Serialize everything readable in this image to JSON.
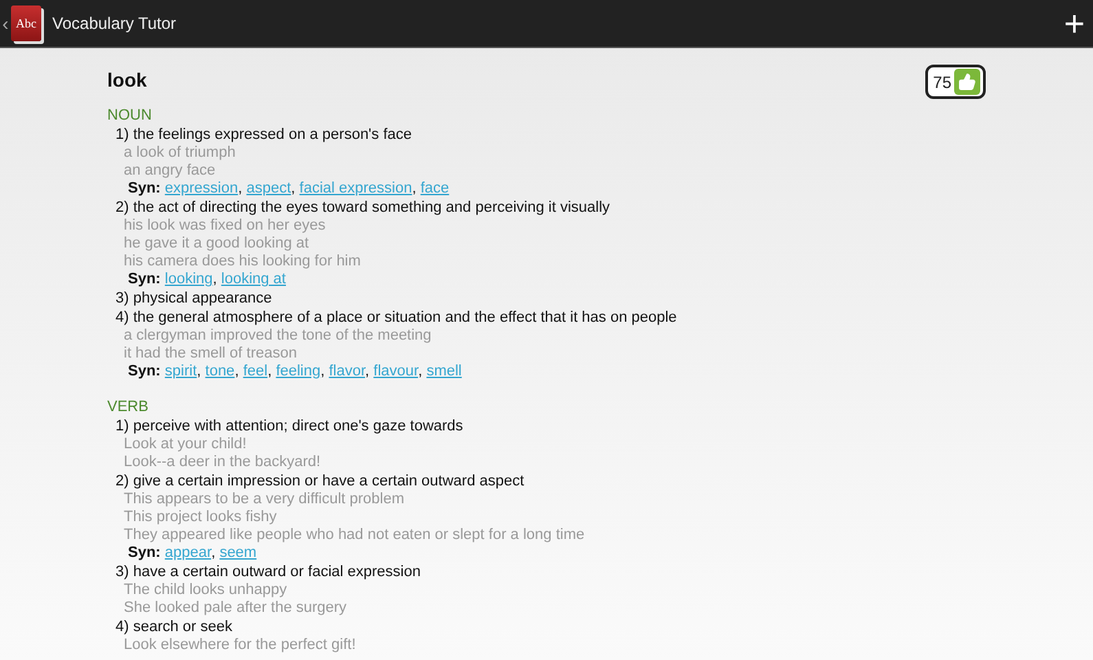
{
  "app_bar": {
    "back": "‹",
    "logo_text": "Abc",
    "title": "Vocabulary Tutor",
    "add": "+"
  },
  "entry": {
    "word": "look",
    "score": "75",
    "sections": [
      {
        "pos": "NOUN",
        "senses": [
          {
            "text": "1) the feelings expressed on a person's face",
            "examples": [
              "a look of triumph",
              "an angry face"
            ],
            "syn_label": "Syn:",
            "synonyms": [
              {
                "word": "expression",
                "sep": ","
              },
              {
                "word": "aspect",
                "sep": ","
              },
              {
                "word": "facial expression",
                "sep": ","
              },
              {
                "word": "face"
              }
            ]
          },
          {
            "text": "2) the act of directing the eyes toward something and perceiving it visually",
            "examples": [
              "his look was fixed on her eyes",
              "he gave it a good looking at",
              "his camera does his looking for him"
            ],
            "syn_label": "Syn:",
            "synonyms": [
              {
                "word": "looking",
                "sep": ","
              },
              {
                "word": "looking at"
              }
            ]
          },
          {
            "text": "3) physical appearance"
          },
          {
            "text": "4) the general atmosphere of a place or situation and the effect that it has on people",
            "examples": [
              "a clergyman improved the tone of the meeting",
              "it had the smell of treason"
            ],
            "syn_label": "Syn:",
            "synonyms": [
              {
                "word": "spirit",
                "sep": ","
              },
              {
                "word": "tone",
                "sep": ","
              },
              {
                "word": "feel",
                "sep": ","
              },
              {
                "word": "feeling",
                "sep": ","
              },
              {
                "word": "flavor",
                "sep": ","
              },
              {
                "word": "flavour",
                "sep": ","
              },
              {
                "word": "smell"
              }
            ]
          }
        ]
      },
      {
        "pos": "VERB",
        "senses": [
          {
            "text": "1) perceive with attention; direct one's gaze towards",
            "examples": [
              "Look at your child!",
              "Look--a deer in the backyard!"
            ]
          },
          {
            "text": "2) give a certain impression or have a certain outward aspect",
            "examples": [
              "This appears to be a very difficult problem",
              "This project looks fishy",
              "They appeared like people who had not eaten or slept for a long time"
            ],
            "syn_label": "Syn:",
            "synonyms": [
              {
                "word": "appear",
                "sep": ","
              },
              {
                "word": "seem"
              }
            ]
          },
          {
            "text": "3) have a certain outward or facial expression",
            "examples": [
              "The child looks unhappy",
              "She looked pale after the surgery"
            ]
          },
          {
            "text": "4) search or seek",
            "examples": [
              "Look elsewhere for the perfect gift!"
            ]
          }
        ]
      }
    ]
  }
}
